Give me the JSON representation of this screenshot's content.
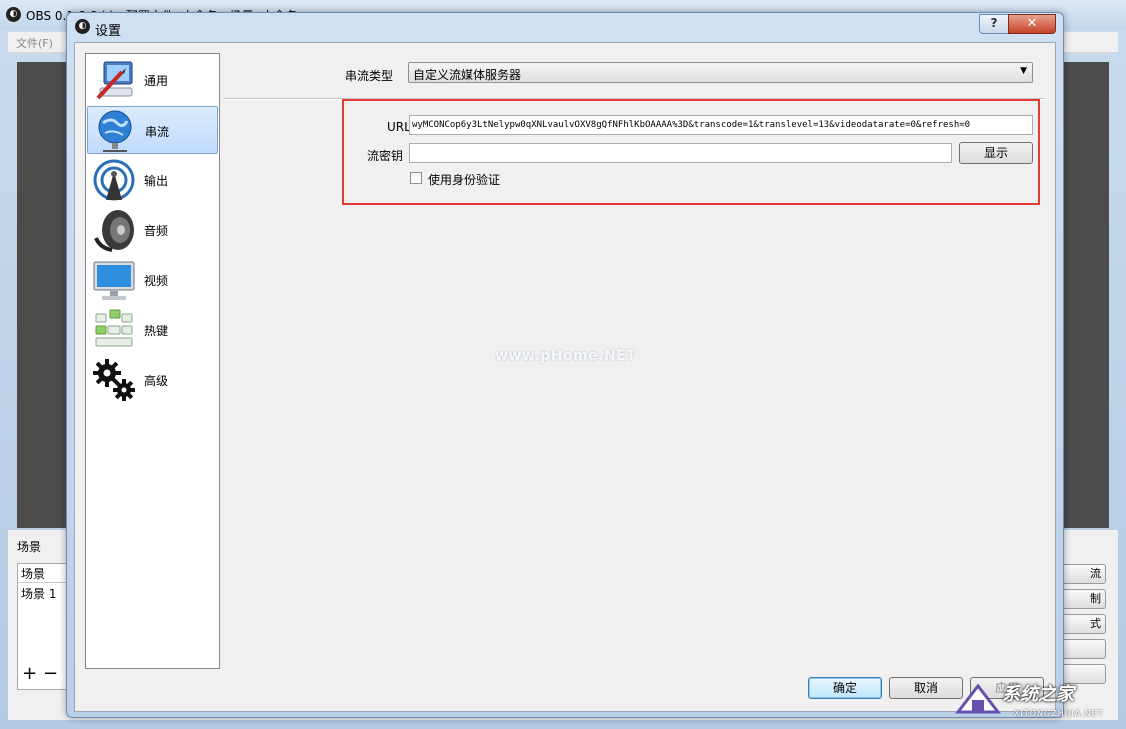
{
  "background_window": {
    "title": "OBS 0.1.6.6 ( ) - 配置文件: 未命名 - 场景: 未命名",
    "menu_file": "文件(F)",
    "scenes_label": "场景",
    "scenes_header": "场景",
    "scene_item": "场景 1",
    "add": "+",
    "remove": "−",
    "right_buttons": [
      "流",
      "制",
      "式",
      "",
      ""
    ]
  },
  "dialog": {
    "title": "设置",
    "help_label": "?",
    "close_label": "✕"
  },
  "sidebar": {
    "items": [
      {
        "label": "通用",
        "icon": "computer-pen-icon"
      },
      {
        "label": "串流",
        "icon": "globe-network-icon",
        "active": true
      },
      {
        "label": "输出",
        "icon": "broadcast-antenna-icon"
      },
      {
        "label": "音频",
        "icon": "speaker-icon"
      },
      {
        "label": "视频",
        "icon": "monitor-icon"
      },
      {
        "label": "热键",
        "icon": "keyboard-icon"
      },
      {
        "label": "高级",
        "icon": "gears-icon"
      }
    ]
  },
  "stream": {
    "type_label": "串流类型",
    "type_value": "自定义流媒体服务器",
    "url_label": "URL",
    "url_value": "wyMCONCop6y3LtNelypw0qXNLvaulvOXV8gQfNFhlKbOAAAA%3D&transcode=1&translevel=13&videodatarate=0&refresh=0",
    "key_label": "流密钥",
    "key_value": "",
    "show_label": "显示",
    "auth_label": "使用身份验证",
    "auth_checked": false
  },
  "footer": {
    "ok_label": "确定",
    "cancel_label": "取消",
    "apply_label": "应用"
  },
  "watermark": "www.pHome.NET",
  "corner_logo": {
    "text": "系统之家",
    "subtext": "XITONGZHIJIA.NET"
  },
  "colors": {
    "highlight": "#e53935",
    "active_nav": "#c1dbfc",
    "close_button": "#c5432a"
  }
}
